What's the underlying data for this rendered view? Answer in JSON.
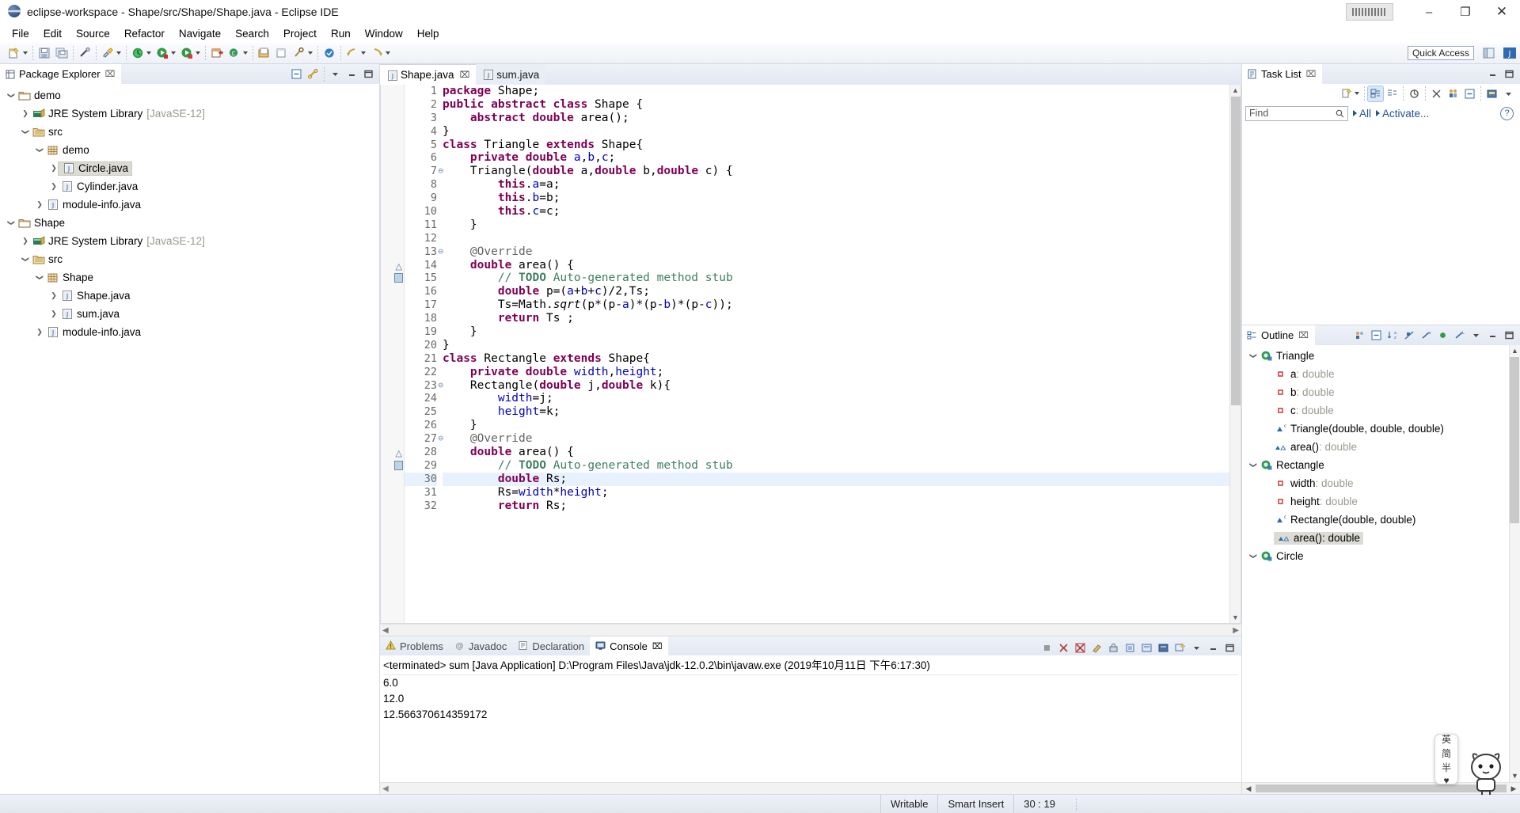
{
  "window": {
    "title": "eclipse-workspace - Shape/src/Shape/Shape.java - Eclipse IDE",
    "app_icon": "eclipse-icon",
    "minimize": "–",
    "maximize": "❐",
    "close": "✕"
  },
  "menubar": [
    {
      "label": "File"
    },
    {
      "label": "Edit"
    },
    {
      "label": "Source"
    },
    {
      "label": "Refactor"
    },
    {
      "label": "Navigate"
    },
    {
      "label": "Search"
    },
    {
      "label": "Project"
    },
    {
      "label": "Run"
    },
    {
      "label": "Window"
    },
    {
      "label": "Help"
    }
  ],
  "toolbar": {
    "quick_access": "Quick Access",
    "icons": [
      "new-wizard-icon",
      "save-icon",
      "save-all-icon",
      "link-icon",
      "build-icon",
      "debug-icon",
      "run-icon",
      "coverage-icon",
      "new-java-project-icon",
      "new-java-class-icon",
      "open-type-icon",
      "search-icon",
      "edit-icon",
      "last-edit-icon",
      "back-icon",
      "forward-icon",
      "pin-icon"
    ],
    "perspective_icons": [
      "open-perspective-icon",
      "java-perspective-icon"
    ]
  },
  "package_explorer": {
    "title": "Package Explorer",
    "close_glyph": "⌧",
    "tools": [
      "collapse-all-icon",
      "link-with-editor-icon",
      "view-menu-icon",
      "minimize-icon",
      "maximize-icon"
    ],
    "tree": [
      {
        "label": "demo",
        "icon": "project-icon",
        "depth": 0,
        "twisty": "down",
        "selected": false
      },
      {
        "label": "JRE System Library",
        "suffix": "[JavaSE-12]",
        "icon": "library-icon",
        "depth": 1,
        "twisty": "right",
        "selected": false
      },
      {
        "label": "src",
        "icon": "source-folder-icon",
        "depth": 1,
        "twisty": "down",
        "selected": false
      },
      {
        "label": "demo",
        "icon": "package-icon",
        "depth": 2,
        "twisty": "down",
        "selected": false
      },
      {
        "label": "Circle.java",
        "icon": "java-file-icon",
        "depth": 3,
        "twisty": "right",
        "selected": true
      },
      {
        "label": "Cylinder.java",
        "icon": "java-file-icon",
        "depth": 3,
        "twisty": "right",
        "selected": false
      },
      {
        "label": "module-info.java",
        "icon": "java-file-icon",
        "depth": 2,
        "twisty": "right",
        "selected": false
      },
      {
        "label": "Shape",
        "icon": "project-icon",
        "depth": 0,
        "twisty": "down",
        "selected": false
      },
      {
        "label": "JRE System Library",
        "suffix": "[JavaSE-12]",
        "icon": "library-icon",
        "depth": 1,
        "twisty": "right",
        "selected": false
      },
      {
        "label": "src",
        "icon": "source-folder-icon",
        "depth": 1,
        "twisty": "down",
        "selected": false
      },
      {
        "label": "Shape",
        "icon": "package-icon",
        "depth": 2,
        "twisty": "down",
        "selected": false
      },
      {
        "label": "Shape.java",
        "icon": "java-file-icon",
        "depth": 3,
        "twisty": "right",
        "selected": false
      },
      {
        "label": "sum.java",
        "icon": "java-file-icon",
        "depth": 3,
        "twisty": "right",
        "selected": false
      },
      {
        "label": "module-info.java",
        "icon": "java-file-icon",
        "depth": 2,
        "twisty": "right",
        "selected": false
      }
    ]
  },
  "editor": {
    "tabs": [
      {
        "label": "Shape.java",
        "active": true,
        "closable": true,
        "icon": "java-file-icon"
      },
      {
        "label": "sum.java",
        "active": false,
        "closable": false,
        "icon": "java-file-icon"
      }
    ],
    "lines": [
      {
        "num": "1",
        "marker": "",
        "html": "<span class='kw'>package</span> Shape;"
      },
      {
        "num": "2",
        "marker": "",
        "html": "<span class='kw'>public abstract class</span> Shape {"
      },
      {
        "num": "3",
        "marker": "",
        "html": "    <span class='kw'>abstract double</span> area();"
      },
      {
        "num": "4",
        "marker": "",
        "html": "}"
      },
      {
        "num": "5",
        "marker": "",
        "html": "<span class='kw'>class</span> Triangle <span class='kw'>extends</span> Shape{"
      },
      {
        "num": "6",
        "marker": "",
        "html": "    <span class='kw'>private double</span> <span class='fld'>a</span>,<span class='fld'>b</span>,<span class='fld'>c</span>;"
      },
      {
        "num": "7",
        "marker": "fold",
        "html": "    Triangle(<span class='kw'>double</span> a,<span class='kw'>double</span> b,<span class='kw'>double</span> c) {"
      },
      {
        "num": "8",
        "marker": "",
        "html": "        <span class='kw'>this</span>.<span class='fld'>a</span>=a;"
      },
      {
        "num": "9",
        "marker": "",
        "html": "        <span class='kw'>this</span>.<span class='fld'>b</span>=b;"
      },
      {
        "num": "10",
        "marker": "",
        "html": "        <span class='kw'>this</span>.<span class='fld'>c</span>=c;"
      },
      {
        "num": "11",
        "marker": "",
        "html": "    }"
      },
      {
        "num": "12",
        "marker": "",
        "html": ""
      },
      {
        "num": "13",
        "marker": "fold",
        "html": "    <span class='ann'>@Override</span>"
      },
      {
        "num": "14",
        "marker": "override",
        "html": "    <span class='kw'>double</span> area() {"
      },
      {
        "num": "15",
        "marker": "todo",
        "html": "        <span class='cmt'>// </span><span class='todo'>TODO</span><span class='cmt'> Auto-generated method stub</span>"
      },
      {
        "num": "16",
        "marker": "",
        "html": "        <span class='kw'>double</span> p=(<span class='fld'>a</span>+<span class='fld'>b</span>+<span class='fld'>c</span>)/2,Ts;"
      },
      {
        "num": "17",
        "marker": "",
        "html": "        Ts=Math.<span class='ital'>sqrt</span>(p*(p-<span class='fld'>a</span>)*(p-<span class='fld'>b</span>)*(p-<span class='fld'>c</span>));"
      },
      {
        "num": "18",
        "marker": "",
        "html": "        <span class='kw'>return</span> Ts ;"
      },
      {
        "num": "19",
        "marker": "",
        "html": "    }"
      },
      {
        "num": "20",
        "marker": "",
        "html": "}"
      },
      {
        "num": "21",
        "marker": "",
        "html": "<span class='kw'>class</span> Rectangle <span class='kw'>extends</span> Shape{"
      },
      {
        "num": "22",
        "marker": "",
        "html": "    <span class='kw'>private double</span> <span class='fld'>width</span>,<span class='fld'>height</span>;"
      },
      {
        "num": "23",
        "marker": "fold",
        "html": "    Rectangle(<span class='kw'>double</span> j,<span class='kw'>double</span> k){"
      },
      {
        "num": "24",
        "marker": "",
        "html": "        <span class='fld'>width</span>=j;"
      },
      {
        "num": "25",
        "marker": "",
        "html": "        <span class='fld'>height</span>=k;"
      },
      {
        "num": "26",
        "marker": "",
        "html": "    }"
      },
      {
        "num": "27",
        "marker": "fold",
        "html": "    <span class='ann'>@Override</span>"
      },
      {
        "num": "28",
        "marker": "override",
        "html": "    <span class='kw'>double</span> area() {"
      },
      {
        "num": "29",
        "marker": "todo",
        "html": "        <span class='cmt'>// </span><span class='todo'>TODO</span><span class='cmt'> Auto-generated method stub</span>"
      },
      {
        "num": "30",
        "marker": "",
        "highlight": true,
        "html": "        <span class='kw'>double</span> Rs;"
      },
      {
        "num": "31",
        "marker": "",
        "html": "        Rs=<span class='fld'>width</span>*<span class='fld'>height</span>;"
      },
      {
        "num": "32",
        "marker": "",
        "html": "        <span class='kw'>return</span> Rs;"
      }
    ]
  },
  "console_panel": {
    "tabs": [
      {
        "label": "Problems",
        "active": false,
        "icon": "problems-icon"
      },
      {
        "label": "Javadoc",
        "active": false,
        "icon": "javadoc-icon"
      },
      {
        "label": "Declaration",
        "active": false,
        "icon": "declaration-icon"
      },
      {
        "label": "Console",
        "active": true,
        "icon": "console-icon",
        "closable": true
      }
    ],
    "header": "<terminated> sum [Java Application] D:\\Program Files\\Java\\jdk-12.0.2\\bin\\javaw.exe (2019年10月11日 下午6:17:30)",
    "output": [
      "6.0",
      "12.0",
      "12.566370614359172"
    ],
    "tools": [
      "terminate-icon",
      "remove-launch-icon",
      "remove-all-icon",
      "clear-console-icon",
      "scroll-lock-icon",
      "pin-console-icon",
      "display-selected-icon",
      "open-console-icon",
      "new-console-view-icon",
      "view-menu-icon",
      "minimize-icon",
      "maximize-icon"
    ]
  },
  "task_list": {
    "title": "Task List",
    "close_glyph": "⌧",
    "find_placeholder": "Find",
    "filter_all": "All",
    "activate": "Activate...",
    "help_glyph": "?",
    "tools": [
      "new-task-icon",
      "categorize-icon",
      "schedule-icon",
      "synchronize-icon",
      "collapse-all-icon",
      "focus-icon",
      "link-icon",
      "restore-icon",
      "view-menu-icon"
    ]
  },
  "outline": {
    "title": "Outline",
    "close_glyph": "⌧",
    "tools": [
      "sync-icon",
      "collapse-all-icon",
      "sort-icon",
      "hide-fields-icon",
      "hide-static-icon",
      "hide-nonpublic-icon",
      "hide-local-icon",
      "view-menu-icon",
      "minimize-icon",
      "maximize-icon"
    ],
    "items": [
      {
        "label": "Triangle",
        "type": "",
        "icon": "class-icon",
        "depth": 0,
        "twisty": "down",
        "selected": false
      },
      {
        "label": "a",
        "type": " : double",
        "icon": "private-field-icon",
        "depth": 1,
        "twisty": "",
        "selected": false
      },
      {
        "label": "b",
        "type": " : double",
        "icon": "private-field-icon",
        "depth": 1,
        "twisty": "",
        "selected": false
      },
      {
        "label": "c",
        "type": " : double",
        "icon": "private-field-icon",
        "depth": 1,
        "twisty": "",
        "selected": false
      },
      {
        "label": "Triangle(double, double, double)",
        "type": "",
        "icon": "constructor-icon",
        "depth": 1,
        "twisty": "",
        "selected": false
      },
      {
        "label": "area()",
        "type": " : double",
        "icon": "method-override-icon",
        "depth": 1,
        "twisty": "",
        "selected": false
      },
      {
        "label": "Rectangle",
        "type": "",
        "icon": "class-icon",
        "depth": 0,
        "twisty": "down",
        "selected": false
      },
      {
        "label": "width",
        "type": " : double",
        "icon": "private-field-icon",
        "depth": 1,
        "twisty": "",
        "selected": false
      },
      {
        "label": "height",
        "type": " : double",
        "icon": "private-field-icon",
        "depth": 1,
        "twisty": "",
        "selected": false
      },
      {
        "label": "Rectangle(double, double)",
        "type": "",
        "icon": "constructor-icon",
        "depth": 1,
        "twisty": "",
        "selected": false
      },
      {
        "label": "area()",
        "type": " : double",
        "icon": "method-override-icon",
        "depth": 1,
        "twisty": "",
        "selected": true
      },
      {
        "label": "Circle",
        "type": "",
        "icon": "class-icon",
        "depth": 0,
        "twisty": "down",
        "selected": false
      }
    ]
  },
  "statusbar": {
    "writable": "Writable",
    "insert_mode": "Smart Insert",
    "position": "30 : 19"
  },
  "ime": {
    "lines": [
      "英",
      "简",
      "半",
      "♥"
    ]
  },
  "colors": {
    "keyword": "#7f0055",
    "comment": "#3f7f5f",
    "field": "#0000c0",
    "selection": "#dcdcd4",
    "highlight_line": "#e8f2fe",
    "link": "#23538f"
  }
}
